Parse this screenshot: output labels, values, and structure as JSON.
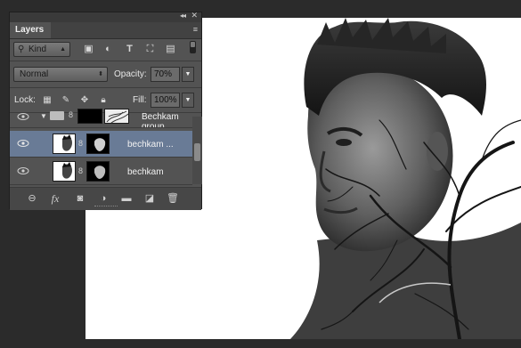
{
  "panel": {
    "tab_label": "Layers",
    "collapse_glyph": "◂◂",
    "close_glyph": "✕",
    "menu_glyph": "≡"
  },
  "filter": {
    "kind_value": "Kind",
    "icons": [
      "image-filter-icon",
      "adjustment-filter-icon",
      "type-filter-icon",
      "shape-filter-icon",
      "smart-object-filter-icon"
    ]
  },
  "blend": {
    "mode_value": "Normal",
    "opacity_label": "Opacity:",
    "opacity_value": "70%"
  },
  "lock": {
    "label": "Lock:",
    "fill_label": "Fill:",
    "fill_value": "100%"
  },
  "layers": [
    {
      "name": "Bechkam group",
      "type": "group",
      "selected": false
    },
    {
      "name": "bechkam ...",
      "type": "layer",
      "selected": true
    },
    {
      "name": "bechkam",
      "type": "layer",
      "selected": false
    }
  ],
  "bottom_icons": [
    "link-icon",
    "fx-icon",
    "mask-icon",
    "adjustment-icon",
    "folder-icon",
    "new-layer-icon",
    "trash-icon"
  ],
  "colors": {
    "panel_bg": "#535353",
    "selected_row": "#697b96",
    "app_bg": "#2b2b2b"
  }
}
